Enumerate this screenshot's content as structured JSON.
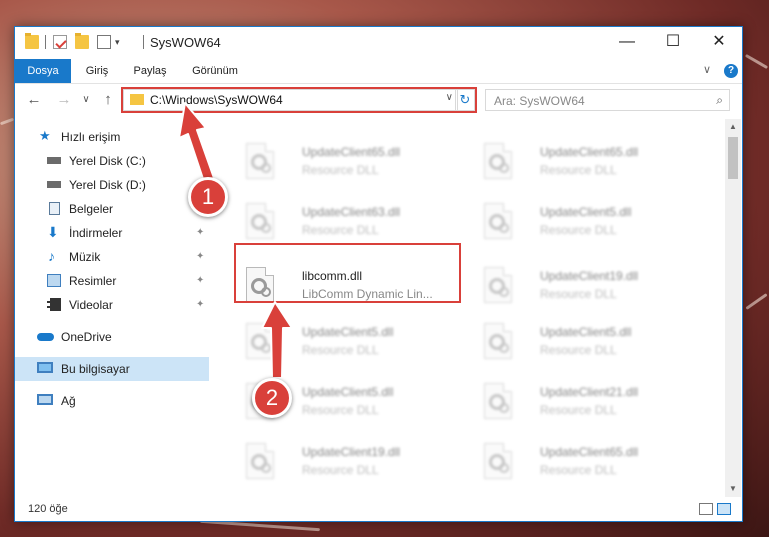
{
  "window": {
    "title": "SysWOW64",
    "controls": {
      "minimize": "—",
      "maximize": "☐",
      "close": "✕"
    }
  },
  "ribbon": {
    "tabs": [
      "Dosya",
      "Giriş",
      "Paylaş",
      "Görünüm"
    ],
    "active_tab": "Dosya",
    "expand_glyph": "∨",
    "help_glyph": "?"
  },
  "address": {
    "path": "C:\\Windows\\SysWOW64",
    "dropdown_glyph": "∨",
    "refresh_glyph": "↻"
  },
  "search": {
    "placeholder": "Ara: SysWOW64",
    "icon": "search-icon"
  },
  "nav": {
    "back": "←",
    "forward": "→",
    "recent": "∨",
    "up": "↑",
    "items": [
      {
        "label": "Hızlı erişim",
        "icon": "star-icon",
        "indent": false,
        "pinned": false
      },
      {
        "label": "Yerel Disk (C:)",
        "icon": "drive-icon",
        "indent": true,
        "pinned": false
      },
      {
        "label": "Yerel Disk (D:)",
        "icon": "drive-icon",
        "indent": true,
        "pinned": false
      },
      {
        "label": "Belgeler",
        "icon": "documents-icon",
        "indent": true,
        "pinned": false
      },
      {
        "label": "İndirmeler",
        "icon": "download-icon",
        "indent": true,
        "pinned": true
      },
      {
        "label": "Müzik",
        "icon": "music-icon",
        "indent": true,
        "pinned": true
      },
      {
        "label": "Resimler",
        "icon": "pictures-icon",
        "indent": true,
        "pinned": true
      },
      {
        "label": "Videolar",
        "icon": "videos-icon",
        "indent": true,
        "pinned": true
      },
      {
        "label": "OneDrive",
        "icon": "cloud-icon",
        "indent": false,
        "pinned": false
      },
      {
        "label": "Bu bilgisayar",
        "icon": "computer-icon",
        "indent": false,
        "pinned": false,
        "selected": true
      },
      {
        "label": "Ağ",
        "icon": "network-icon",
        "indent": false,
        "pinned": false
      }
    ],
    "pin_glyph": "📌"
  },
  "files": [
    {
      "name": "UpdateClient65.dll",
      "type": "Resource DLL",
      "blurred": true
    },
    {
      "name": "UpdateClient65.dll",
      "type": "Resource DLL",
      "blurred": true
    },
    {
      "name": "UpdateClient63.dll",
      "type": "Resource DLL",
      "blurred": true
    },
    {
      "name": "UpdateClient5.dll",
      "type": "Resource DLL",
      "blurred": true
    },
    {
      "name": "libcomm.dll",
      "type": "LibComm Dynamic Lin...",
      "blurred": false,
      "highlighted": true
    },
    {
      "name": "UpdateClient19.dll",
      "type": "Resource DLL",
      "blurred": true
    },
    {
      "name": "UpdateClient5.dll",
      "type": "Resource DLL",
      "blurred": true
    },
    {
      "name": "UpdateClient5.dll",
      "type": "Resource DLL",
      "blurred": true
    },
    {
      "name": "UpdateClient5.dll",
      "type": "Resource DLL",
      "blurred": true
    },
    {
      "name": "UpdateClient21.dll",
      "type": "Resource DLL",
      "blurred": true
    },
    {
      "name": "UpdateClient19.dll",
      "type": "Resource DLL",
      "blurred": true
    },
    {
      "name": "UpdateClient65.dll",
      "type": "Resource DLL",
      "blurred": true
    }
  ],
  "status": {
    "item_count": "120 öğe"
  },
  "callouts": {
    "step1": "1",
    "step2": "2",
    "color": "#d9403a"
  },
  "accent": "#1979ca"
}
